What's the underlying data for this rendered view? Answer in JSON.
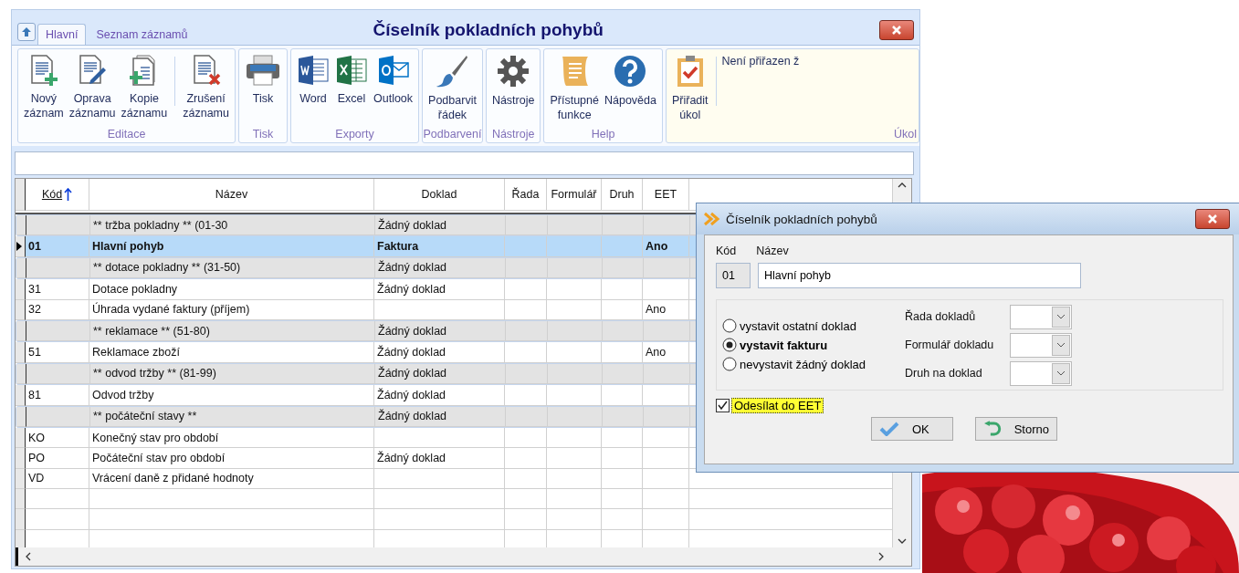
{
  "window": {
    "title": "Číselník pokladních pohybů",
    "tabs": [
      {
        "label": "Hlavní",
        "selected": true
      },
      {
        "label": "Seznam záznamů",
        "selected": false
      }
    ]
  },
  "ribbon": {
    "groups": [
      {
        "label": "Editace",
        "buttons": [
          {
            "kind": "new",
            "lines": [
              "Nový",
              "záznam"
            ]
          },
          {
            "kind": "edit",
            "lines": [
              "Oprava",
              "záznamu"
            ]
          },
          {
            "kind": "copy",
            "lines": [
              "Kopie",
              "záznamu"
            ]
          },
          {
            "kind": "delete",
            "lines": [
              "Zrušení",
              "záznamu"
            ]
          }
        ]
      },
      {
        "label": "Tisk",
        "buttons": [
          {
            "kind": "print",
            "lines": [
              "Tisk"
            ]
          }
        ]
      },
      {
        "label": "Exporty",
        "buttons": [
          {
            "kind": "word",
            "lines": [
              "Word"
            ]
          },
          {
            "kind": "excel",
            "lines": [
              "Excel"
            ]
          },
          {
            "kind": "outlook",
            "lines": [
              "Outlook"
            ]
          }
        ]
      },
      {
        "label": "Podbarvení",
        "buttons": [
          {
            "kind": "brush",
            "lines": [
              "Podbarvit",
              "řádek"
            ]
          }
        ]
      },
      {
        "label": "Nástroje",
        "buttons": [
          {
            "kind": "gear",
            "lines": [
              "Nástroje"
            ]
          }
        ]
      },
      {
        "label": "Help",
        "buttons": [
          {
            "kind": "scroll",
            "lines": [
              "Přístupné",
              "funkce"
            ]
          },
          {
            "kind": "help",
            "lines": [
              "Nápověda"
            ]
          }
        ]
      },
      {
        "label": "Úkol",
        "kind": "task",
        "buttons": [
          {
            "kind": "clipboard",
            "lines": [
              "Přiřadit",
              "úkol"
            ]
          }
        ],
        "note": "Není přiřazen ž"
      }
    ]
  },
  "table": {
    "columns": [
      {
        "label": "Kód",
        "sorted": true
      },
      {
        "label": "Název"
      },
      {
        "label": "Doklad"
      },
      {
        "label": "Řada"
      },
      {
        "label": "Formulář"
      },
      {
        "label": "Druh"
      },
      {
        "label": "EET"
      }
    ],
    "rows": [
      {
        "kind": "group",
        "selected": false,
        "cells": [
          "",
          "** tržba pokladny **   (01-30",
          "Žádný doklad",
          "",
          "",
          "",
          ""
        ]
      },
      {
        "kind": "record",
        "selected": true,
        "cells": [
          "01",
          "Hlavní pohyb",
          "Faktura",
          "",
          "",
          "",
          "Ano"
        ]
      },
      {
        "kind": "group",
        "selected": false,
        "cells": [
          "",
          "** dotace pokladny **  (31-50)",
          "Žádný doklad",
          "",
          "",
          "",
          ""
        ]
      },
      {
        "kind": "record",
        "selected": false,
        "cells": [
          "31",
          "Dotace pokladny",
          "Žádný doklad",
          "",
          "",
          "",
          ""
        ]
      },
      {
        "kind": "record",
        "selected": false,
        "cells": [
          "32",
          "Úhrada vydané faktury (příjem)",
          "",
          "",
          "",
          "",
          "Ano"
        ]
      },
      {
        "kind": "group",
        "selected": false,
        "cells": [
          "",
          "** reklamace **         (51-80)",
          "Žádný doklad",
          "",
          "",
          "",
          ""
        ]
      },
      {
        "kind": "record",
        "selected": false,
        "cells": [
          "51",
          "Reklamace zboží",
          "Žádný doklad",
          "",
          "",
          "",
          "Ano"
        ]
      },
      {
        "kind": "group",
        "selected": false,
        "cells": [
          "",
          "** odvod tržby **       (81-99)",
          "Žádný doklad",
          "",
          "",
          "",
          ""
        ]
      },
      {
        "kind": "record",
        "selected": false,
        "cells": [
          "81",
          "Odvod tržby",
          "Žádný doklad",
          "",
          "",
          "",
          ""
        ]
      },
      {
        "kind": "group",
        "selected": false,
        "cells": [
          "",
          "** počáteční stavy **",
          "Žádný doklad",
          "",
          "",
          "",
          ""
        ]
      },
      {
        "kind": "record",
        "selected": false,
        "cells": [
          "KO",
          "Konečný stav pro období",
          "",
          "",
          "",
          "",
          ""
        ]
      },
      {
        "kind": "record",
        "selected": false,
        "cells": [
          "PO",
          "Počáteční stav pro období",
          "Žádný doklad",
          "",
          "",
          "",
          ""
        ]
      },
      {
        "kind": "record",
        "selected": false,
        "cells": [
          "VD",
          "Vrácení daně z přidané hodnoty",
          "",
          "",
          "",
          "",
          ""
        ]
      }
    ]
  },
  "dialog": {
    "title": "Číselník pokladních pohybů",
    "code_label": "Kód",
    "name_label": "Název",
    "code_value": "01",
    "name_value": "Hlavní pohyb",
    "radios": [
      {
        "label": "vystavit ostatní doklad",
        "selected": false
      },
      {
        "label": "vystavit fakturu",
        "selected": true
      },
      {
        "label": "nevystavit žádný doklad",
        "selected": false
      }
    ],
    "combos": [
      {
        "label": "Řada dokladů"
      },
      {
        "label": "Formulář dokladu"
      },
      {
        "label": "Druh na doklad"
      }
    ],
    "checkbox": {
      "label": "Odesílat do EET",
      "checked": true,
      "focused": true
    },
    "buttons": [
      {
        "kind": "ok",
        "label": "OK"
      },
      {
        "kind": "cancel",
        "label": "Storno"
      }
    ]
  }
}
